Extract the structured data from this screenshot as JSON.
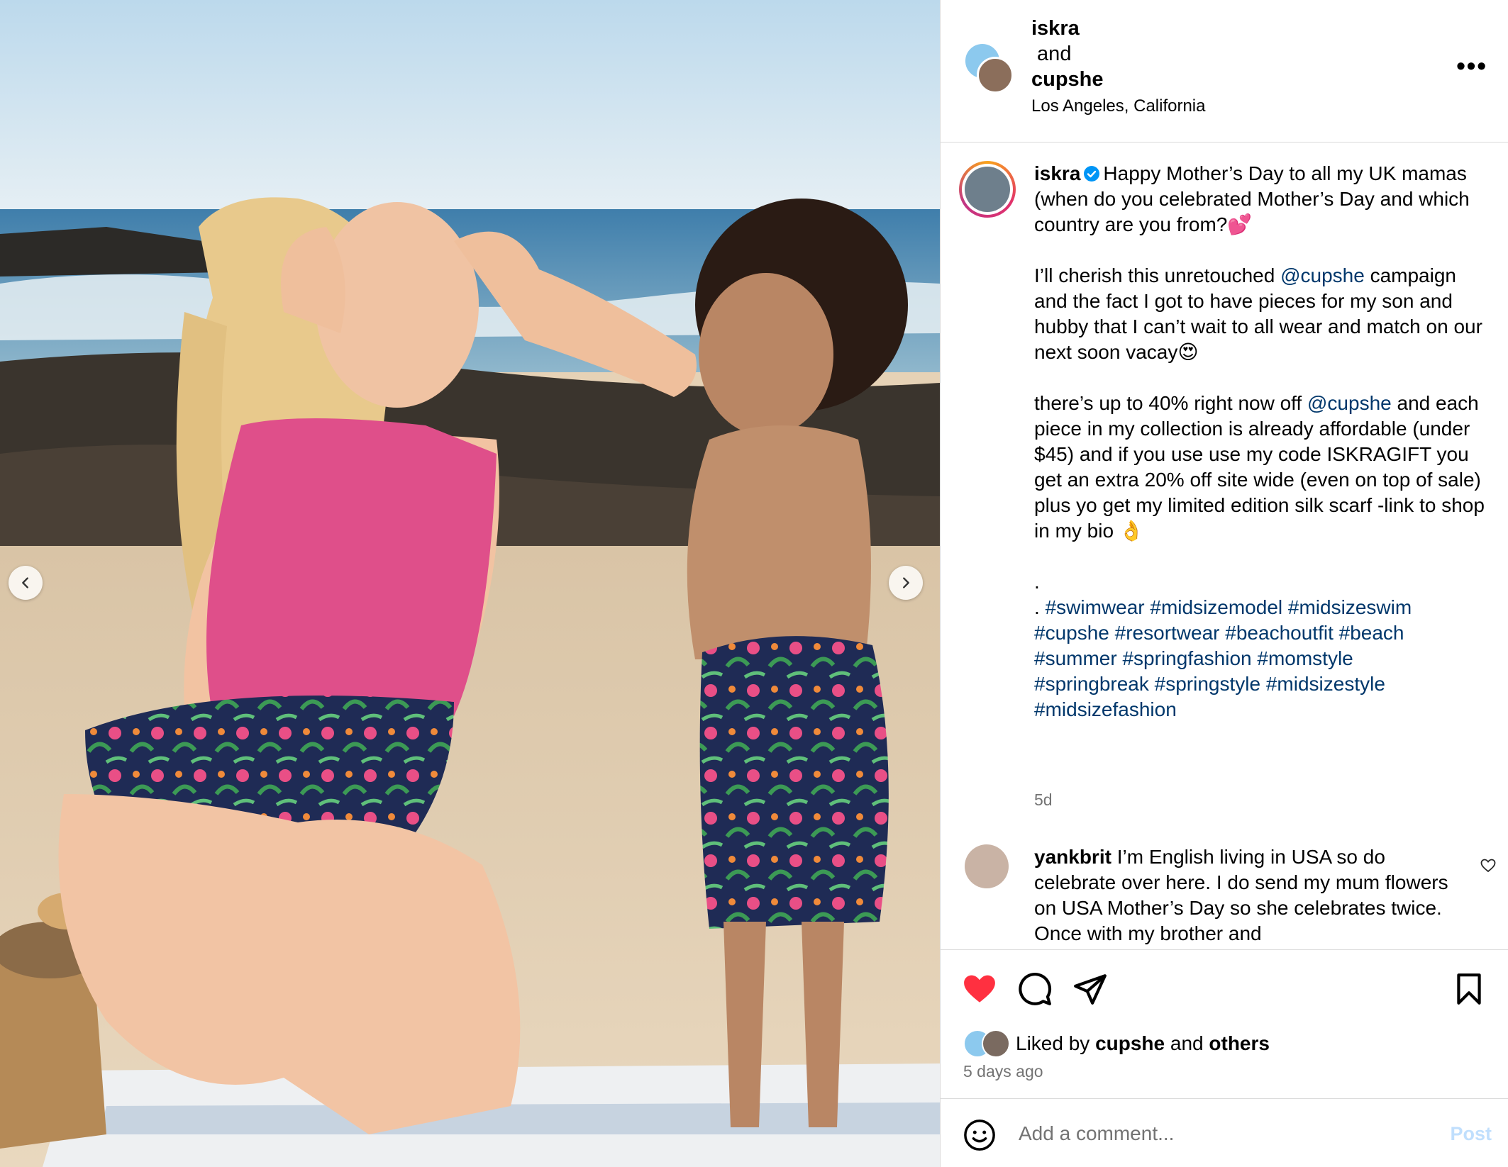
{
  "post": {
    "author_line1": "iskra",
    "author_and": " and",
    "author_line2": "cupshe",
    "location": "Los Angeles, California",
    "more_label": "•••"
  },
  "caption": {
    "username": "iskra",
    "text_1": "Happy Mother’s Day to all my UK mamas (when do you celebrated Mother’s Day and which country are you from?💕\n\nI’ll cherish this unretouched ",
    "mention_1": "@cupshe",
    "text_2": " campaign and the fact I got to have pieces for my son and hubby that I can’t wait to all wear and match on our next soon vacay😍\n\nthere’s up to 40% right now off ",
    "mention_2": "@cupshe",
    "text_3": " and each piece in my collection is already affordable (under $45) and if you use use my code ISKRAGIFT you get an extra 20% off site wide (even on top of sale) plus yo get my limited edition silk scarf -link to shop in my bio 👌\n\n.\n. ",
    "hashtags": [
      "#swimwear",
      "#midsizemodel",
      "#midsizeswim",
      "#cupshe",
      "#resortwear",
      "#beachoutfit",
      "#beach",
      "#summer",
      "#springfashion",
      "#momstyle",
      "#springbreak",
      "#springstyle",
      "#midsizestyle",
      "#midsizefashion"
    ],
    "age": "5d"
  },
  "comment": {
    "username": "yankbrit",
    "text": "I’m English living in USA so do celebrate over here. I do send my mum flowers on USA Mother’s Day so she celebrates twice. Once with my brother and"
  },
  "likes": {
    "prefix": "Liked by ",
    "user": "cupshe",
    "mid": " and ",
    "others": "others",
    "time": "5 days ago"
  },
  "add_comment": {
    "placeholder": "Add a comment...",
    "post_label": "Post"
  },
  "icons": {
    "prev": "chevron-left-icon",
    "next": "chevron-right-icon",
    "like": "heart-filled-icon",
    "comment": "comment-icon",
    "share": "send-icon",
    "save": "bookmark-icon",
    "emoji": "smile-icon",
    "verified": "verified-badge-icon"
  },
  "colors": {
    "like_red": "#ff3040",
    "link_blue": "#00376b",
    "verified_blue": "#0095f6",
    "muted": "#737373",
    "post_disabled": "#c0dffd"
  }
}
